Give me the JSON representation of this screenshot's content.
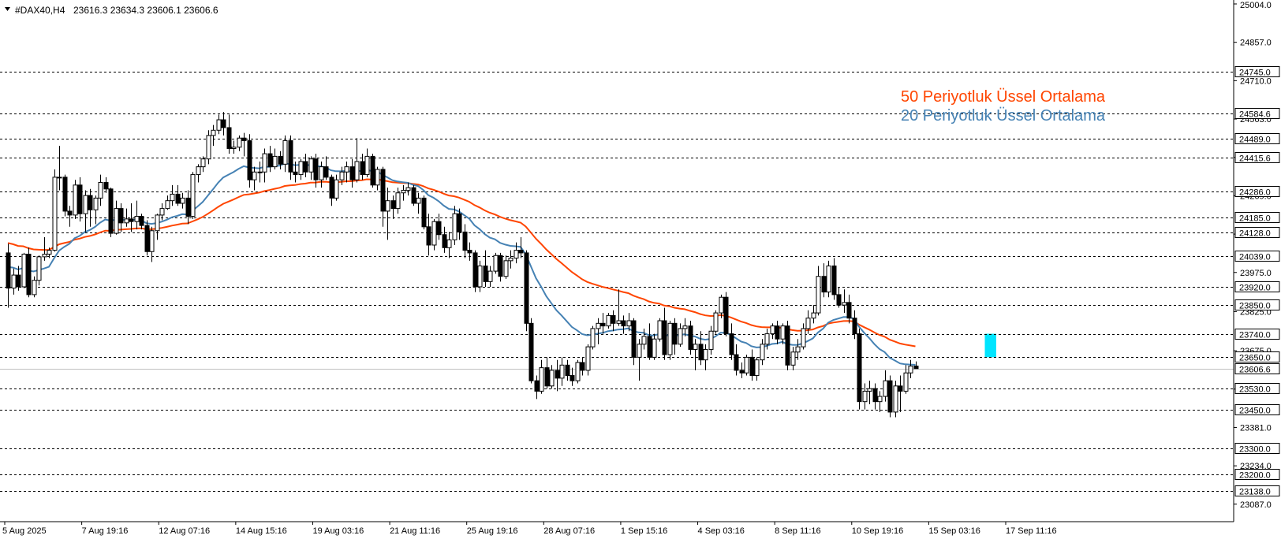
{
  "header": {
    "symbol": "#DAX40,H4",
    "ohlc": "23616.3 23634.3 23606.1 23606.6"
  },
  "colors": {
    "ema50": "#ff4500",
    "ema20": "#4682b4",
    "zone": "#00e5ff",
    "candle": "#000000",
    "grid": "#000000",
    "bid_line": "#c0c0c0"
  },
  "chart_data": {
    "type": "candlestick",
    "ylim": [
      23020,
      25004
    ],
    "grid": "dashed horizontal levels",
    "legend_placement": "top-right",
    "legend": [
      {
        "name": "50 Periyotluk Üssel Ortalama",
        "color": "#ff4500"
      },
      {
        "name": "20 Periyotluk Üssel Ortalama",
        "color": "#4682b4"
      }
    ],
    "price_ticks": [
      "25004.0",
      "24857.0",
      "24710.0",
      "24563.0",
      "24416.0",
      "24269.0",
      "24122.0",
      "23975.0",
      "23825.0",
      "23675.0",
      "23528.0",
      "23381.0",
      "23234.0",
      "23087.0"
    ],
    "levels": [
      "24745.0",
      "24584.6",
      "24489.0",
      "24415.6",
      "24286.0",
      "24185.0",
      "24128.0",
      "24039.0",
      "23920.0",
      "23850.0",
      "23740.0",
      "23650.0",
      "23530.0",
      "23450.0",
      "23300.0",
      "23200.0",
      "23138.0"
    ],
    "current_price": "23606.6",
    "x_labels": [
      "5 Aug 2025",
      "7 Aug 19:16",
      "12 Aug 07:16",
      "14 Aug 15:16",
      "19 Aug 03:16",
      "21 Aug 11:16",
      "25 Aug 19:16",
      "28 Aug 07:16",
      "1 Sep 15:16",
      "4 Sep 03:16",
      "8 Sep 11:16",
      "10 Sep 19:16",
      "15 Sep 03:16",
      "17 Sep 11:16"
    ],
    "zone": {
      "from": 23650,
      "to": 23740,
      "start_bar": 191
    },
    "ohlc": [
      [
        24050,
        24085,
        23840,
        23915
      ],
      [
        23915,
        23990,
        23890,
        23965
      ],
      [
        23965,
        24000,
        23905,
        23920
      ],
      [
        23920,
        24050,
        23915,
        24045
      ],
      [
        24045,
        24070,
        23880,
        23890
      ],
      [
        23890,
        23960,
        23880,
        23945
      ],
      [
        23945,
        24040,
        23925,
        24035
      ],
      [
        24035,
        24110,
        24020,
        24045
      ],
      [
        24045,
        24070,
        24030,
        24060
      ],
      [
        24060,
        24370,
        24055,
        24340
      ],
      [
        24340,
        24460,
        24290,
        24340
      ],
      [
        24340,
        24350,
        24190,
        24210
      ],
      [
        24210,
        24230,
        24150,
        24195
      ],
      [
        24195,
        24330,
        24180,
        24310
      ],
      [
        24310,
        24340,
        24170,
        24200
      ],
      [
        24200,
        24290,
        24130,
        24270
      ],
      [
        24270,
        24295,
        24150,
        24215
      ],
      [
        24215,
        24270,
        24160,
        24260
      ],
      [
        24260,
        24350,
        24230,
        24320
      ],
      [
        24320,
        24340,
        24280,
        24295
      ],
      [
        24295,
        24300,
        24110,
        24125
      ],
      [
        24125,
        24250,
        24120,
        24220
      ],
      [
        24220,
        24240,
        24130,
        24165
      ],
      [
        24165,
        24220,
        24150,
        24180
      ],
      [
        24180,
        24240,
        24130,
        24170
      ],
      [
        24170,
        24250,
        24140,
        24190
      ],
      [
        24190,
        24200,
        24140,
        24155
      ],
      [
        24155,
        24175,
        24040,
        24055
      ],
      [
        24055,
        24150,
        24015,
        24135
      ],
      [
        24135,
        24200,
        24100,
        24195
      ],
      [
        24195,
        24240,
        24175,
        24220
      ],
      [
        24220,
        24270,
        24215,
        24250
      ],
      [
        24250,
        24310,
        24230,
        24275
      ],
      [
        24275,
        24310,
        24230,
        24240
      ],
      [
        24240,
        24280,
        24220,
        24260
      ],
      [
        24260,
        24290,
        24160,
        24190
      ],
      [
        24190,
        24360,
        24180,
        24350
      ],
      [
        24350,
        24390,
        24320,
        24380
      ],
      [
        24380,
        24420,
        24360,
        24410
      ],
      [
        24410,
        24520,
        24390,
        24500
      ],
      [
        24500,
        24540,
        24460,
        24520
      ],
      [
        24520,
        24580,
        24505,
        24560
      ],
      [
        24560,
        24590,
        24500,
        24530
      ],
      [
        24530,
        24580,
        24430,
        24450
      ],
      [
        24450,
        24480,
        24430,
        24455
      ],
      [
        24455,
        24500,
        24440,
        24490
      ],
      [
        24490,
        24510,
        24420,
        24480
      ],
      [
        24480,
        24505,
        24300,
        24330
      ],
      [
        24330,
        24380,
        24290,
        24360
      ],
      [
        24360,
        24400,
        24320,
        24360
      ],
      [
        24360,
        24450,
        24320,
        24430
      ],
      [
        24430,
        24460,
        24360,
        24380
      ],
      [
        24380,
        24450,
        24370,
        24420
      ],
      [
        24420,
        24440,
        24370,
        24390
      ],
      [
        24390,
        24500,
        24360,
        24480
      ],
      [
        24480,
        24500,
        24330,
        24360
      ],
      [
        24360,
        24400,
        24320,
        24350
      ],
      [
        24350,
        24410,
        24330,
        24400
      ],
      [
        24400,
        24430,
        24340,
        24360
      ],
      [
        24360,
        24420,
        24330,
        24410
      ],
      [
        24410,
        24430,
        24300,
        24330
      ],
      [
        24330,
        24400,
        24300,
        24380
      ],
      [
        24380,
        24420,
        24330,
        24340
      ],
      [
        24340,
        24350,
        24230,
        24260
      ],
      [
        24260,
        24350,
        24250,
        24330
      ],
      [
        24330,
        24380,
        24310,
        24360
      ],
      [
        24360,
        24400,
        24320,
        24380
      ],
      [
        24380,
        24410,
        24300,
        24330
      ],
      [
        24330,
        24490,
        24320,
        24400
      ],
      [
        24400,
        24430,
        24330,
        24350
      ],
      [
        24350,
        24450,
        24340,
        24420
      ],
      [
        24420,
        24430,
        24300,
        24310
      ],
      [
        24310,
        24380,
        24290,
        24370
      ],
      [
        24370,
        24380,
        24150,
        24210
      ],
      [
        24210,
        24300,
        24100,
        24250
      ],
      [
        24250,
        24270,
        24180,
        24220
      ],
      [
        24220,
        24300,
        24200,
        24280
      ],
      [
        24280,
        24310,
        24250,
        24290
      ],
      [
        24290,
        24320,
        24270,
        24300
      ],
      [
        24300,
        24310,
        24230,
        24240
      ],
      [
        24240,
        24280,
        24200,
        24260
      ],
      [
        24260,
        24270,
        24140,
        24150
      ],
      [
        24150,
        24200,
        24040,
        24080
      ],
      [
        24080,
        24180,
        24060,
        24170
      ],
      [
        24170,
        24200,
        24100,
        24120
      ],
      [
        24120,
        24150,
        24050,
        24070
      ],
      [
        24070,
        24130,
        24030,
        24100
      ],
      [
        24100,
        24230,
        24080,
        24200
      ],
      [
        24200,
        24220,
        24100,
        24130
      ],
      [
        24130,
        24160,
        24030,
        24060
      ],
      [
        24060,
        24090,
        24020,
        24050
      ],
      [
        24050,
        24060,
        23900,
        23920
      ],
      [
        23920,
        24020,
        23900,
        24000
      ],
      [
        24000,
        24060,
        23920,
        23940
      ],
      [
        23940,
        24000,
        23920,
        23980
      ],
      [
        23980,
        24050,
        23970,
        24040
      ],
      [
        24040,
        24050,
        23940,
        23960
      ],
      [
        23960,
        24040,
        23950,
        24020
      ],
      [
        24020,
        24060,
        23990,
        24030
      ],
      [
        24030,
        24090,
        24010,
        24060
      ],
      [
        24060,
        24110,
        24030,
        24050
      ],
      [
        24050,
        24060,
        23750,
        23780
      ],
      [
        23780,
        23800,
        23550,
        23560
      ],
      [
        23560,
        23580,
        23490,
        23520
      ],
      [
        23520,
        23640,
        23510,
        23610
      ],
      [
        23610,
        23650,
        23530,
        23540
      ],
      [
        23540,
        23620,
        23530,
        23600
      ],
      [
        23600,
        23640,
        23520,
        23570
      ],
      [
        23570,
        23650,
        23540,
        23620
      ],
      [
        23620,
        23640,
        23560,
        23580
      ],
      [
        23580,
        23610,
        23540,
        23560
      ],
      [
        23560,
        23640,
        23550,
        23630
      ],
      [
        23630,
        23650,
        23580,
        23600
      ],
      [
        23600,
        23700,
        23580,
        23690
      ],
      [
        23690,
        23770,
        23680,
        23760
      ],
      [
        23760,
        23800,
        23700,
        23780
      ],
      [
        23780,
        23820,
        23740,
        23770
      ],
      [
        23770,
        23820,
        23760,
        23810
      ],
      [
        23810,
        23830,
        23750,
        23780
      ],
      [
        23780,
        23910,
        23770,
        23790
      ],
      [
        23790,
        23810,
        23740,
        23770
      ],
      [
        23770,
        23820,
        23750,
        23790
      ],
      [
        23790,
        23800,
        23620,
        23650
      ],
      [
        23650,
        23720,
        23560,
        23700
      ],
      [
        23700,
        23760,
        23680,
        23730
      ],
      [
        23730,
        23780,
        23640,
        23650
      ],
      [
        23650,
        23740,
        23640,
        23720
      ],
      [
        23720,
        23800,
        23710,
        23790
      ],
      [
        23790,
        23840,
        23640,
        23660
      ],
      [
        23660,
        23790,
        23640,
        23780
      ],
      [
        23780,
        23800,
        23660,
        23700
      ],
      [
        23700,
        23780,
        23690,
        23760
      ],
      [
        23760,
        23800,
        23730,
        23770
      ],
      [
        23770,
        23790,
        23660,
        23680
      ],
      [
        23680,
        23720,
        23600,
        23700
      ],
      [
        23700,
        23750,
        23620,
        23640
      ],
      [
        23640,
        23700,
        23600,
        23680
      ],
      [
        23680,
        23770,
        23660,
        23750
      ],
      [
        23750,
        23830,
        23740,
        23820
      ],
      [
        23820,
        23890,
        23800,
        23880
      ],
      [
        23880,
        23900,
        23730,
        23740
      ],
      [
        23740,
        23780,
        23640,
        23660
      ],
      [
        23660,
        23700,
        23580,
        23600
      ],
      [
        23600,
        23630,
        23570,
        23590
      ],
      [
        23590,
        23660,
        23580,
        23650
      ],
      [
        23650,
        23680,
        23560,
        23580
      ],
      [
        23580,
        23650,
        23560,
        23640
      ],
      [
        23640,
        23720,
        23620,
        23700
      ],
      [
        23700,
        23760,
        23680,
        23740
      ],
      [
        23740,
        23780,
        23720,
        23770
      ],
      [
        23770,
        23790,
        23700,
        23720
      ],
      [
        23720,
        23780,
        23700,
        23770
      ],
      [
        23770,
        23790,
        23600,
        23620
      ],
      [
        23620,
        23690,
        23600,
        23670
      ],
      [
        23670,
        23720,
        23640,
        23690
      ],
      [
        23690,
        23780,
        23680,
        23760
      ],
      [
        23760,
        23830,
        23740,
        23800
      ],
      [
        23800,
        23850,
        23780,
        23820
      ],
      [
        23820,
        24000,
        23810,
        23960
      ],
      [
        23960,
        24010,
        23880,
        23900
      ],
      [
        23900,
        24020,
        23880,
        24000
      ],
      [
        24000,
        24030,
        23870,
        23890
      ],
      [
        23890,
        23920,
        23840,
        23850
      ],
      [
        23850,
        23910,
        23820,
        23860
      ],
      [
        23860,
        23890,
        23780,
        23800
      ],
      [
        23800,
        23830,
        23720,
        23740
      ],
      [
        23740,
        23760,
        23450,
        23480
      ],
      [
        23480,
        23550,
        23450,
        23520
      ],
      [
        23520,
        23560,
        23470,
        23530
      ],
      [
        23530,
        23550,
        23450,
        23480
      ],
      [
        23480,
        23520,
        23440,
        23500
      ],
      [
        23500,
        23600,
        23480,
        23560
      ],
      [
        23560,
        23580,
        23420,
        23440
      ],
      [
        23440,
        23560,
        23420,
        23540
      ],
      [
        23540,
        23580,
        23440,
        23520
      ],
      [
        23520,
        23620,
        23510,
        23590
      ],
      [
        23590,
        23640,
        23570,
        23616.3
      ],
      [
        23616.3,
        23634.3,
        23606.1,
        23606.6
      ]
    ]
  }
}
